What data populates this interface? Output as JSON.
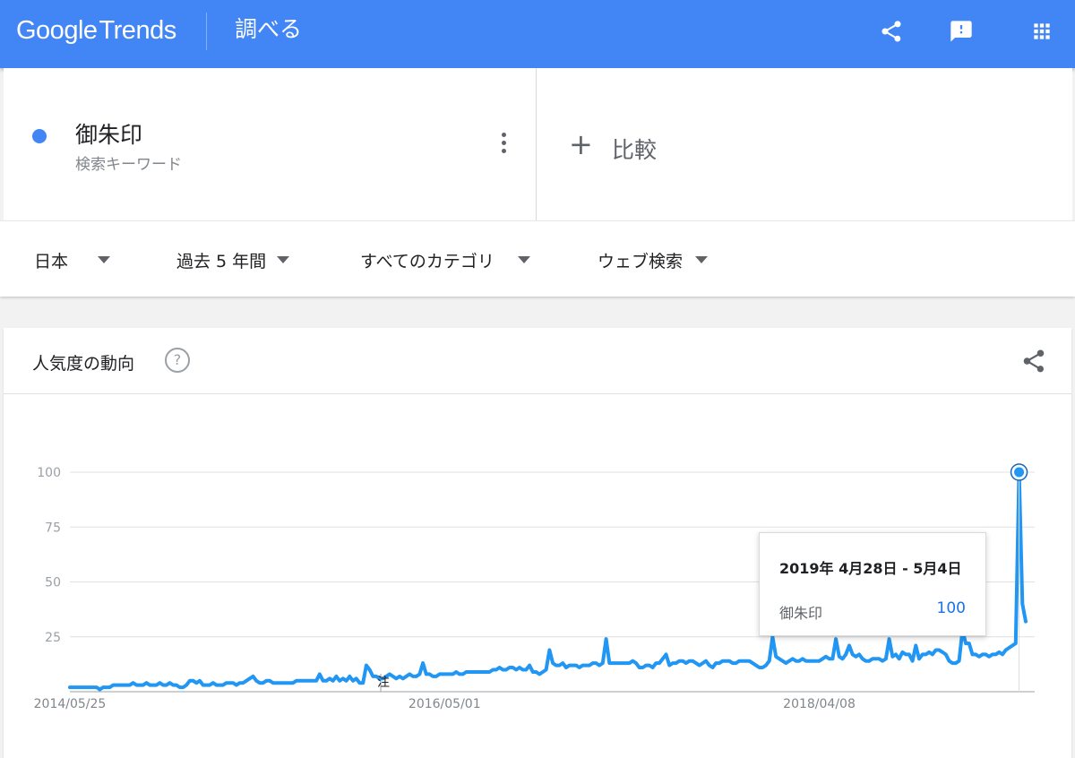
{
  "header": {
    "logo_google": "Google",
    "logo_trends": "Trends",
    "title": "調べる",
    "icons": [
      "share-icon",
      "feedback-icon",
      "apps-icon"
    ]
  },
  "term": {
    "name": "御朱印",
    "type": "検索キーワード",
    "color": "#4285f4"
  },
  "compare": {
    "plus": "+",
    "label": "比較"
  },
  "filters": {
    "region": "日本",
    "period": "過去 5 年間",
    "category": "すべてのカテゴリ",
    "search_type": "ウェブ検索"
  },
  "trend": {
    "title": "人気度の動向",
    "help": "?",
    "note_marker": "注"
  },
  "tooltip": {
    "date": "2019年 4月28日 - 5月4日",
    "term": "御朱印",
    "value": "100"
  },
  "chart_data": {
    "type": "line",
    "ylim": [
      0,
      100
    ],
    "yticks": [
      25,
      50,
      75,
      100
    ],
    "ytick_labels": [
      "25",
      "50",
      "75",
      "100"
    ],
    "xtick_labels": [
      "2014/05/25",
      "2016/05/01",
      "2018/04/08"
    ],
    "line_color": "#2196f3",
    "grid": true,
    "series": [
      {
        "name": "御朱印",
        "values": [
          2,
          2,
          2,
          2,
          2,
          2,
          2,
          2,
          2,
          1,
          2,
          2,
          2,
          3,
          3,
          3,
          3,
          3,
          3,
          4,
          3,
          3,
          3,
          4,
          3,
          3,
          3,
          4,
          3,
          3,
          4,
          3,
          3,
          2,
          2,
          3,
          5,
          5,
          4,
          5,
          3,
          3,
          3,
          4,
          3,
          3,
          3,
          4,
          4,
          4,
          3,
          4,
          4,
          5,
          6,
          7,
          5,
          4,
          4,
          5,
          5,
          4,
          4,
          4,
          4,
          4,
          4,
          4,
          5,
          5,
          5,
          5,
          5,
          5,
          5,
          8,
          5,
          5,
          6,
          5,
          7,
          5,
          6,
          5,
          7,
          5,
          6,
          4,
          4,
          12,
          10,
          7,
          7,
          6,
          6,
          7,
          8,
          7,
          6,
          7,
          6,
          7,
          8,
          7,
          7,
          8,
          13,
          8,
          8,
          7,
          7,
          8,
          8,
          8,
          8,
          8,
          9,
          8,
          8,
          9,
          9,
          9,
          9,
          9,
          9,
          9,
          9,
          10,
          10,
          11,
          10,
          10,
          11,
          11,
          10,
          11,
          10,
          10,
          12,
          9,
          9,
          8,
          9,
          10,
          19,
          13,
          12,
          12,
          13,
          11,
          12,
          12,
          12,
          11,
          12,
          12,
          12,
          13,
          13,
          12,
          13,
          24,
          13,
          13,
          13,
          13,
          13,
          13,
          13,
          14,
          13,
          11,
          11,
          12,
          12,
          11,
          13,
          13,
          15,
          17,
          12,
          13,
          13,
          14,
          14,
          13,
          14,
          14,
          13,
          12,
          13,
          14,
          12,
          11,
          13,
          13,
          14,
          14,
          14,
          13,
          13,
          14,
          14,
          14,
          14,
          13,
          12,
          11,
          11,
          12,
          14,
          25,
          16,
          15,
          14,
          13,
          14,
          15,
          14,
          14,
          15,
          14,
          14,
          14,
          14,
          14,
          15,
          16,
          15,
          15,
          24,
          16,
          15,
          17,
          21,
          17,
          16,
          17,
          15,
          14,
          14,
          15,
          15,
          15,
          14,
          15,
          24,
          16,
          17,
          15,
          18,
          17,
          17,
          14,
          21,
          15,
          17,
          17,
          18,
          17,
          19,
          19,
          18,
          17,
          14,
          13,
          13,
          14,
          28,
          22,
          22,
          17,
          17,
          16,
          17,
          17,
          16,
          17,
          17,
          18,
          17,
          19,
          20,
          21,
          22,
          100,
          40,
          32
        ]
      }
    ],
    "highlight": {
      "label": "2019年 4月28日 - 5月4日",
      "value": 100
    }
  }
}
